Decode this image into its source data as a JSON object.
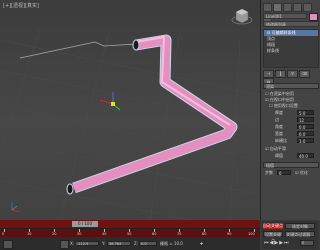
{
  "viewport": {
    "label": "[+][透视][真实]"
  },
  "panel": {
    "object_name": "Line001",
    "modifier_list": "修改器列表",
    "stack": [
      "⊟ 可编辑样条线",
      "顶点",
      "线段",
      "样条线"
    ],
    "rollout_title": "渲染",
    "enable_render": "在渲染中启用",
    "enable_viewport": "在视口中启用",
    "use_viewport_settings": "使用视口设置",
    "params": [
      {
        "label": "厚度",
        "value": "5.0"
      },
      {
        "label": "边",
        "value": "12"
      },
      {
        "label": "角度",
        "value": "0.0"
      },
      {
        "label": "宽度",
        "value": "6.0"
      },
      {
        "label": "纵横比",
        "value": "1.0"
      }
    ],
    "auto_smooth": "自动平滑",
    "threshold_label": "阈值",
    "threshold_value": "40.0",
    "interp_title": "插值",
    "interp_steps_label": "步数",
    "interp_steps_value": "6",
    "optimize": "优化"
  },
  "timeline": {
    "slider": "0 / 100",
    "ticks": [
      "0",
      "10",
      "20",
      "30",
      "40",
      "50",
      "60",
      "70",
      "80",
      "90",
      "100"
    ]
  },
  "status": {
    "x_label": "X:",
    "x_value": "-112.5",
    "y_label": "Y:",
    "y_value": "38.764",
    "z_label": "Z:",
    "z_value": "0.0",
    "grid": "栅格 = 10.0",
    "autokey": "自动关键点",
    "selected": "选定对象",
    "setkey": "设置关键点",
    "keyfilter": "关键点过滤器...",
    "frame": "0"
  },
  "colors": {
    "tube": "#e38fc0",
    "timeline": "#6e1111"
  }
}
